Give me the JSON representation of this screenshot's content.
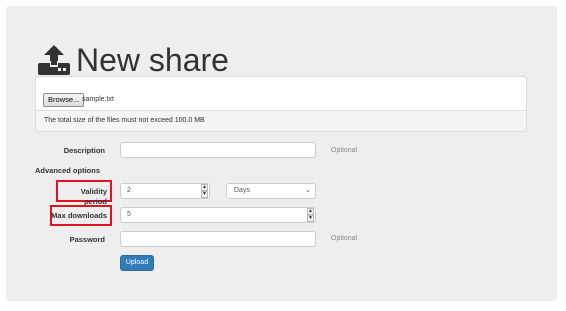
{
  "header": {
    "title": "New share",
    "icon": "upload-icon"
  },
  "file_panel": {
    "browse_label": "Browse...",
    "file_name": "sample.txt",
    "size_notice": "The total size of the files must not exceed 100.0 MB"
  },
  "form": {
    "description": {
      "label": "Description",
      "value": "",
      "hint": "Optional"
    },
    "advanced_heading": "Advanced options",
    "validity": {
      "label": "Validity period",
      "value": "2",
      "unit": "Days"
    },
    "max_downloads": {
      "label": "Max downloads",
      "value": "5"
    },
    "password": {
      "label": "Password",
      "value": "",
      "hint": "Optional"
    },
    "upload_label": "Upload"
  },
  "colors": {
    "background": "#eeeeee",
    "primary": "#337ab7",
    "highlight": "#e0141e"
  }
}
